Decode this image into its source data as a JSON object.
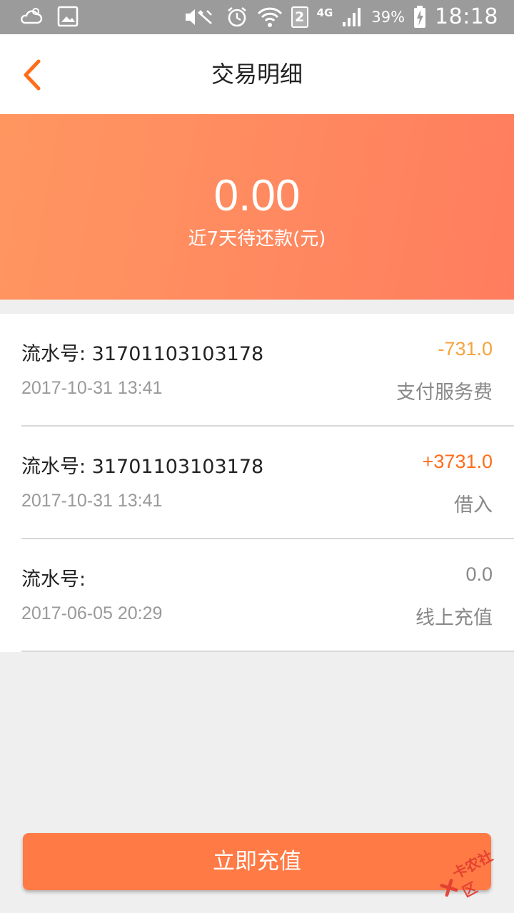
{
  "statusbar": {
    "signal_text": "4G",
    "sim_slot": "2",
    "battery": "39%",
    "time": "18:18"
  },
  "header": {
    "title": "交易明细"
  },
  "summary": {
    "amount": "0.00",
    "label": "近7天待还款(元)"
  },
  "transactions": [
    {
      "serial": "流水号: 31701103103178",
      "datetime": "2017-10-31 13:41",
      "amount": "-731.0",
      "type": "支付服务费",
      "color": "#f8a23a"
    },
    {
      "serial": "流水号: 31701103103178",
      "datetime": "2017-10-31 13:41",
      "amount": "+3731.0",
      "type": "借入",
      "color": "#ff6d1a"
    },
    {
      "serial": "流水号:",
      "datetime": "2017-06-05 20:29",
      "amount": "0.0",
      "type": "线上充值",
      "color": "#888888"
    }
  ],
  "action": {
    "recharge_label": "立即充值"
  },
  "watermark": {
    "text": "卡农社区"
  },
  "colors": {
    "accent": "#ff7a45",
    "back_arrow": "#ff6d1a"
  }
}
